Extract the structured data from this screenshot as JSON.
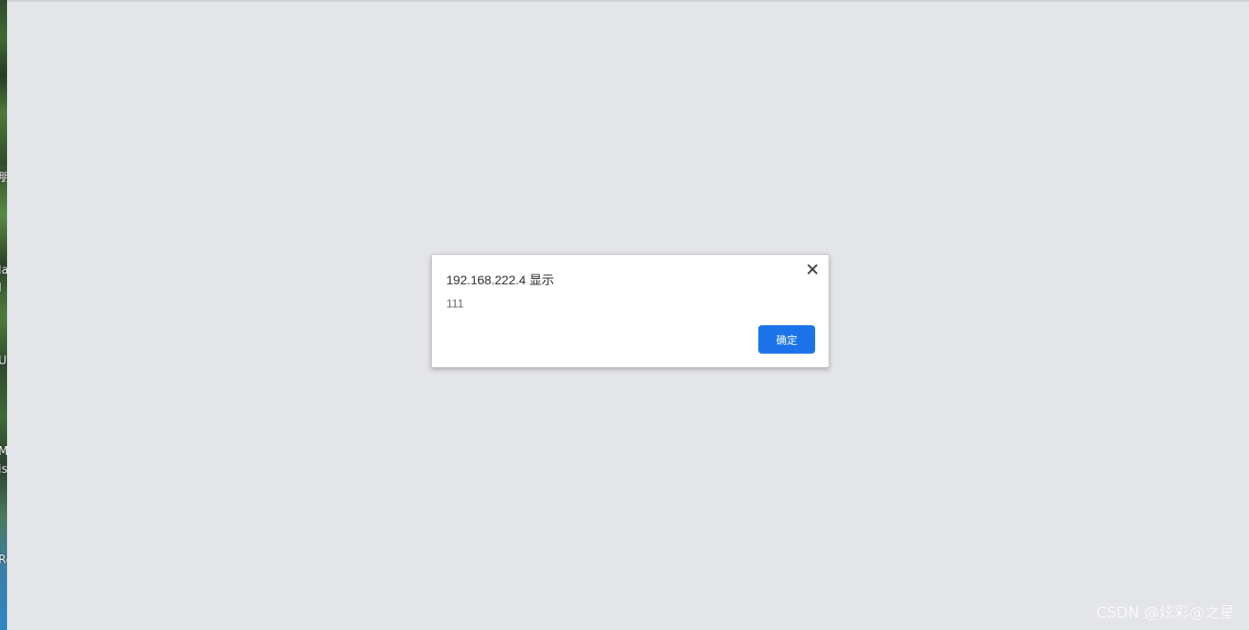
{
  "desktop": {
    "labels": [
      "朋",
      "la",
      "I",
      "Us",
      "M",
      "is",
      "Re"
    ]
  },
  "dialog": {
    "title": "192.168.222.4 显示",
    "message": "111",
    "ok_label": "确定",
    "close_icon": "close-icon",
    "accent_color": "#1a73e8"
  },
  "watermark": {
    "text": "CSDN @炫彩@之星"
  }
}
